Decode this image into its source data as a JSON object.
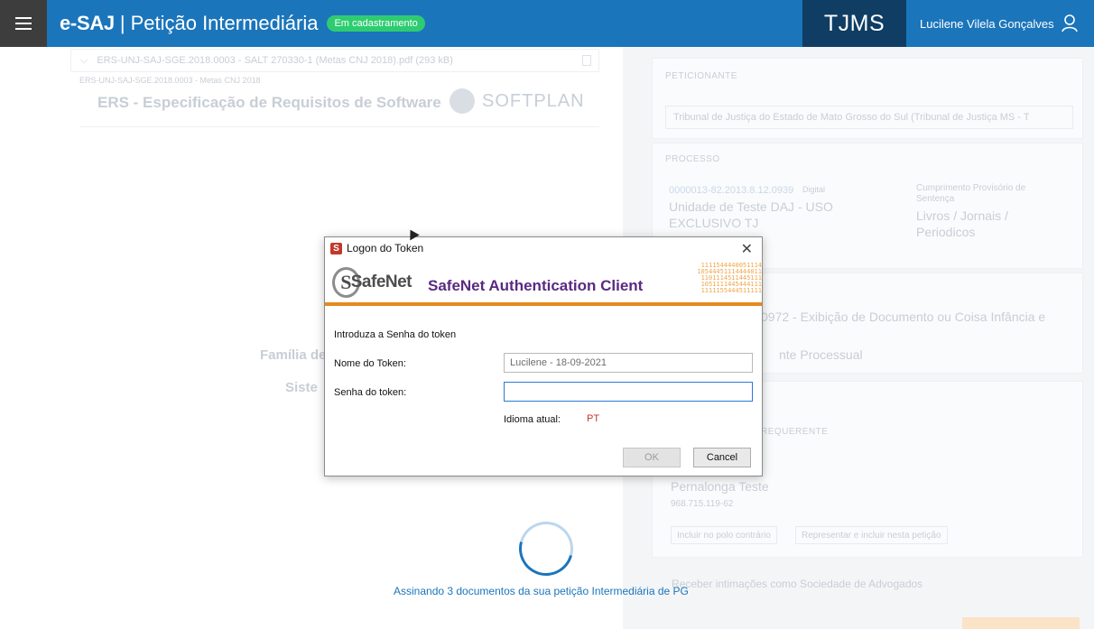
{
  "header": {
    "brand": "e-SAJ",
    "separator": "|",
    "page_title": "Petição Intermediária",
    "status_badge": "Em cadastramento",
    "court": "TJMS",
    "user_name": "Lucilene Vilela Gonçalves",
    "icons": {
      "menu": "hamburger-icon",
      "user": "user-icon"
    }
  },
  "background": {
    "document_row": "ERS-UNJ-SAJ-SGE.2018.0003 - SALT 270330-1 (Metas CNJ 2018).pdf (293 kB)",
    "document_subtitle": "ERS-UNJ-SAJ-SGE.2018.0003 - Metas CNJ 2018",
    "document_title": "ERS - Especificação de Requisitos de Software",
    "logo_text": "SOFTPLAN",
    "familia": "Família de",
    "sistem": "Siste",
    "peticionante_label": "Peticionante",
    "peticionante_value": "Tribunal de Justiça do Estado de Mato Grosso do Sul (Tribunal de Justiça MS - T",
    "processo_label": "Processo",
    "processo_number": "0000013-82.2013.8.12.0939",
    "processo_tag": "Digital",
    "processo_unit_1": "Unidade de Teste DAJ - USO",
    "processo_unit_2": "EXCLUSIVO TJ",
    "processo_class_1": "Cumprimento Provisório de",
    "processo_class_2": "Sentença",
    "processo_subject_1": "Livros / Jornais /",
    "processo_subject_2": "Periodicos",
    "classe_text": "0972 - Exibição de Documento ou Coisa Infância e",
    "incidente_text": "nte Processual",
    "partes_label": "Requerente",
    "party_name": "Pernalonga Teste",
    "party_doc": "968.715.119-62",
    "btn_polo": "Incluir no polo contrário",
    "btn_representar": "Representar e incluir nesta petição",
    "intimacoes": "Receber intimações como Sociedade de Advogados"
  },
  "loading": {
    "message": "Assinando 3 documentos da sua petição Intermediária de PG"
  },
  "dialog": {
    "title": "Logon do Token",
    "logo_text": "SafeNet",
    "product": "SafeNet Authentication Client",
    "digits": "1111544440051114\n10544451114444011\n1101114511445111\n1051111445444111\n1111155444511111",
    "intro": "Introduza a Senha do token",
    "token_name_label": "Nome do Token:",
    "token_name_value": "Lucilene - 18-09-2021",
    "password_label": "Senha do token:",
    "password_value": "",
    "language_label": "Idioma atual:",
    "language_value": "PT",
    "ok_label": "OK",
    "cancel_label": "Cancel",
    "icons": {
      "title": "safenet-icon",
      "close": "close-icon"
    }
  },
  "colors": {
    "topbar": "#1b75bb",
    "court_block": "#0f3d63",
    "badge": "#2ecc71",
    "banner_stripe": "#e58a1f",
    "product_text": "#5a2a82",
    "language_value": "#c0392b"
  }
}
